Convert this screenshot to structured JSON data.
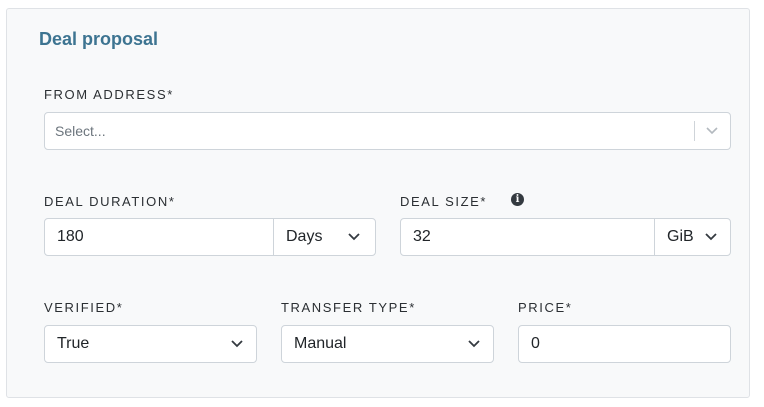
{
  "form": {
    "title": "Deal proposal",
    "from_address": {
      "label": "FROM ADDRESS*",
      "placeholder": "Select..."
    },
    "deal_duration": {
      "label": "DEAL DURATION*",
      "value": "180",
      "unit": "Days"
    },
    "deal_size": {
      "label": "DEAL SIZE*",
      "value": "32",
      "unit": "GiB"
    },
    "verified": {
      "label": "VERIFIED*",
      "value": "True"
    },
    "transfer_type": {
      "label": "TRANSFER TYPE*",
      "value": "Manual"
    },
    "price": {
      "label": "PRICE*",
      "value": "0"
    }
  },
  "icons": {
    "info": "info-icon",
    "chevron": "chevron-down-icon"
  },
  "colors": {
    "title": "#3d7491",
    "panel_bg": "#f8f9fa",
    "border": "#ced4da"
  }
}
